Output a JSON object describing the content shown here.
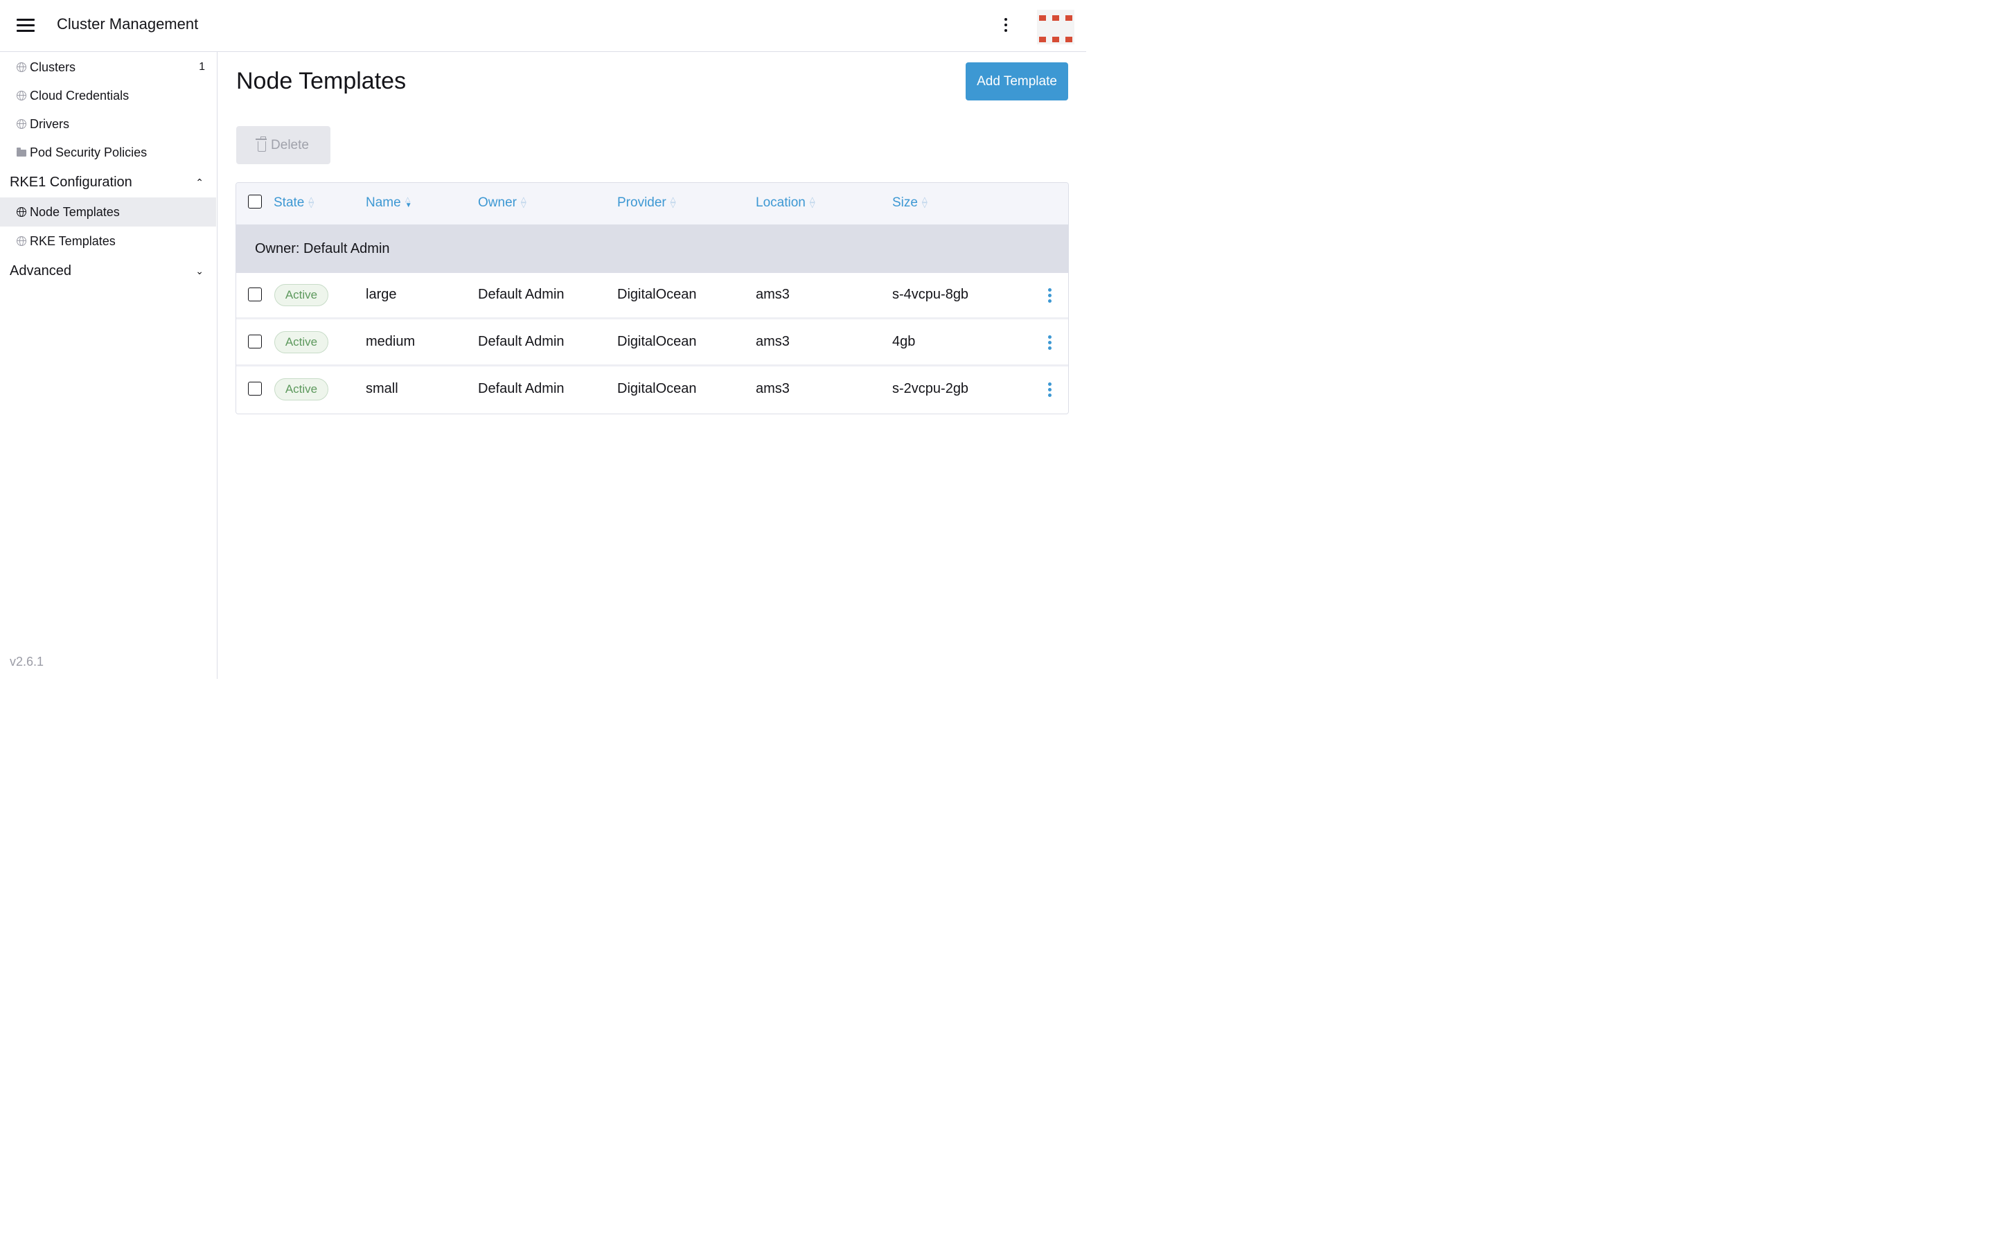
{
  "header": {
    "title": "Cluster Management",
    "menu_icon": "hamburger-icon",
    "more_icon": "kebab-icon",
    "brand_color": "#d64c35"
  },
  "sidebar": {
    "items": [
      {
        "label": "Clusters",
        "icon": "globe-icon",
        "count": "1"
      },
      {
        "label": "Cloud Credentials",
        "icon": "globe-icon"
      },
      {
        "label": "Drivers",
        "icon": "globe-icon"
      },
      {
        "label": "Pod Security Policies",
        "icon": "folder-icon"
      }
    ],
    "groups": [
      {
        "label": "RKE1 Configuration",
        "expanded": true,
        "items": [
          {
            "label": "Node Templates",
            "icon": "globe-icon",
            "active": true
          },
          {
            "label": "RKE Templates",
            "icon": "globe-icon"
          }
        ]
      },
      {
        "label": "Advanced",
        "expanded": false
      }
    ],
    "version": "v2.6.1"
  },
  "main": {
    "title": "Node Templates",
    "add_button": "Add Template",
    "delete_button": "Delete",
    "accent_color": "#3d98d3"
  },
  "table": {
    "columns": [
      "State",
      "Name",
      "Owner",
      "Provider",
      "Location",
      "Size"
    ],
    "sorted_column": "Name",
    "group_label": "Owner: Default Admin",
    "rows": [
      {
        "state": "Active",
        "name": "large",
        "owner": "Default Admin",
        "provider": "DigitalOcean",
        "location": "ams3",
        "size": "s-4vcpu-8gb"
      },
      {
        "state": "Active",
        "name": "medium",
        "owner": "Default Admin",
        "provider": "DigitalOcean",
        "location": "ams3",
        "size": "4gb"
      },
      {
        "state": "Active",
        "name": "small",
        "owner": "Default Admin",
        "provider": "DigitalOcean",
        "location": "ams3",
        "size": "s-2vcpu-2gb"
      }
    ]
  }
}
